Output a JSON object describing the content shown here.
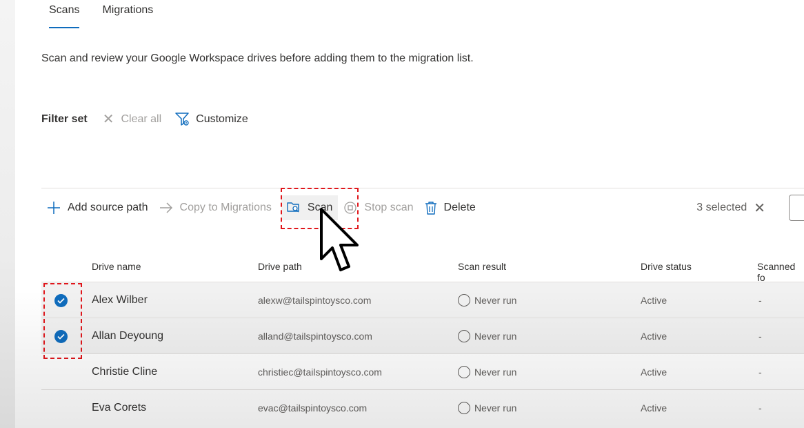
{
  "tabs": [
    {
      "label": "Scans",
      "active": true
    },
    {
      "label": "Migrations",
      "active": false
    }
  ],
  "description": "Scan and review your Google Workspace drives before adding them to the migration list.",
  "filter": {
    "label": "Filter set",
    "clear_all": "Clear all",
    "customize": "Customize"
  },
  "commands": {
    "add_source_path": "Add source path",
    "copy_to_migrations": "Copy to Migrations",
    "scan": "Scan",
    "stop_scan": "Stop scan",
    "delete": "Delete",
    "selected_count": "3 selected"
  },
  "table": {
    "columns": [
      "Drive name",
      "Drive path",
      "Scan result",
      "Drive status",
      "Scanned fo"
    ],
    "rows": [
      {
        "selected": true,
        "name": "Alex Wilber",
        "path": "alexw@tailspintoysco.com",
        "scan_result": "Never run",
        "status": "Active",
        "scanned": "-"
      },
      {
        "selected": true,
        "name": "Allan Deyoung",
        "path": "alland@tailspintoysco.com",
        "scan_result": "Never run",
        "status": "Active",
        "scanned": "-"
      },
      {
        "selected": false,
        "name": "Christie Cline",
        "path": "christiec@tailspintoysco.com",
        "scan_result": "Never run",
        "status": "Active",
        "scanned": "-"
      },
      {
        "selected": false,
        "name": "Eva Corets",
        "path": "evac@tailspintoysco.com",
        "scan_result": "Never run",
        "status": "Active",
        "scanned": "-"
      }
    ]
  },
  "colors": {
    "accent": "#0f6cbd",
    "annotation": "#e0161b"
  },
  "icons": [
    "close-icon",
    "filter-settings-icon",
    "plus-icon",
    "arrow-right-icon",
    "folder-scan-icon",
    "stop-icon",
    "trash-icon",
    "checkmark-circle-icon",
    "radio-empty-icon",
    "mouse-pointer-icon"
  ]
}
